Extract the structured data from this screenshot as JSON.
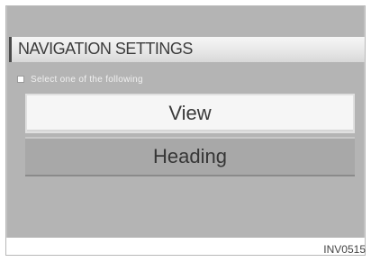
{
  "screen": {
    "title": "NAVIGATION SETTINGS",
    "instruction": "Select one of the following",
    "options": [
      {
        "label": "View",
        "state": "highlighted"
      },
      {
        "label": "Heading",
        "state": "normal"
      }
    ]
  },
  "figure": {
    "code": "INV0515"
  }
}
